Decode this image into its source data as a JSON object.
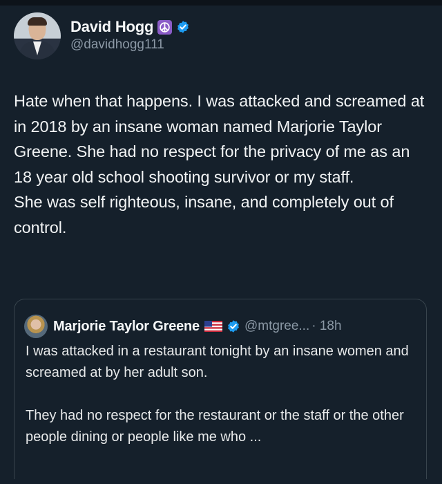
{
  "post": {
    "author": {
      "display_name": "David Hogg",
      "handle": "@davidhogg111",
      "badge_emoji": "peace-symbol",
      "verified": true,
      "verified_color": "#1d9bf0"
    },
    "text": "Hate when that happens. I was attacked and screamed at in 2018 by an insane woman named Marjorie Taylor Greene. She had no respect for the privacy of me as an 18 year old school shooting survivor or my staff.\nShe was self righteous, insane, and completely out of control."
  },
  "quoted_post": {
    "author": {
      "display_name": "Marjorie Taylor Greene",
      "handle": "@mtgree...",
      "timestamp": "· 18h",
      "badge_emoji": "us-flag",
      "verified": true
    },
    "text_1": "I was attacked in a restaurant tonight by an insane women and screamed at by her adult son.",
    "text_2": "They had no respect for the restaurant or the staff or the other people dining or people like me who ..."
  },
  "colors": {
    "background": "#15202b",
    "text": "#e7e9ea",
    "secondary_text": "#8b98a5",
    "border": "#38444d",
    "badge_purple": "#8b5cc7"
  }
}
